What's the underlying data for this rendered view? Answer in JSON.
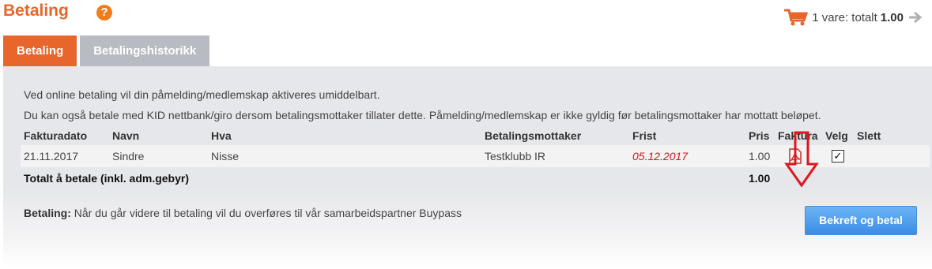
{
  "header": {
    "title": "Betaling",
    "help_glyph": "?",
    "cart": {
      "label": "1 vare: totalt",
      "amount": "1.00"
    }
  },
  "tabs": [
    {
      "label": "Betaling",
      "active": true
    },
    {
      "label": "Betalingshistorikk",
      "active": false
    }
  ],
  "info": {
    "line1": "Ved online betaling vil din påmelding/medlemskap aktiveres umiddelbart.",
    "line2": "Du kan også betale med KID nettbank/giro dersom betalingsmottaker tillater dette. Påmelding/medlemskap er ikke gyldig før betalingsmottaker har mottatt beløpet."
  },
  "table": {
    "columns": [
      "Fakturadato",
      "Navn",
      "Hva",
      "Betalingsmottaker",
      "Frist",
      "Pris",
      "Faktura",
      "Velg",
      "Slett"
    ],
    "rows": [
      {
        "date": "21.11.2017",
        "name": "Sindre",
        "what": "Nisse",
        "recipient": "Testklubb IR",
        "deadline": "05.12.2017",
        "price": "1.00",
        "invoice_icon": "pdf-icon",
        "selected": true
      }
    ],
    "total_label": "Totalt å betale (inkl. adm.gebyr)",
    "total_value": "1.00"
  },
  "footer": {
    "label": "Betaling:",
    "text": "Når du går videre til betaling vil du overføres til vår samarbeidspartner Buypass",
    "confirm_button": "Bekreft og betal"
  },
  "colors": {
    "accent": "#e8662c",
    "deadline": "#d4141a",
    "button": "#3a8ce6",
    "arrow": "#e0161c"
  }
}
